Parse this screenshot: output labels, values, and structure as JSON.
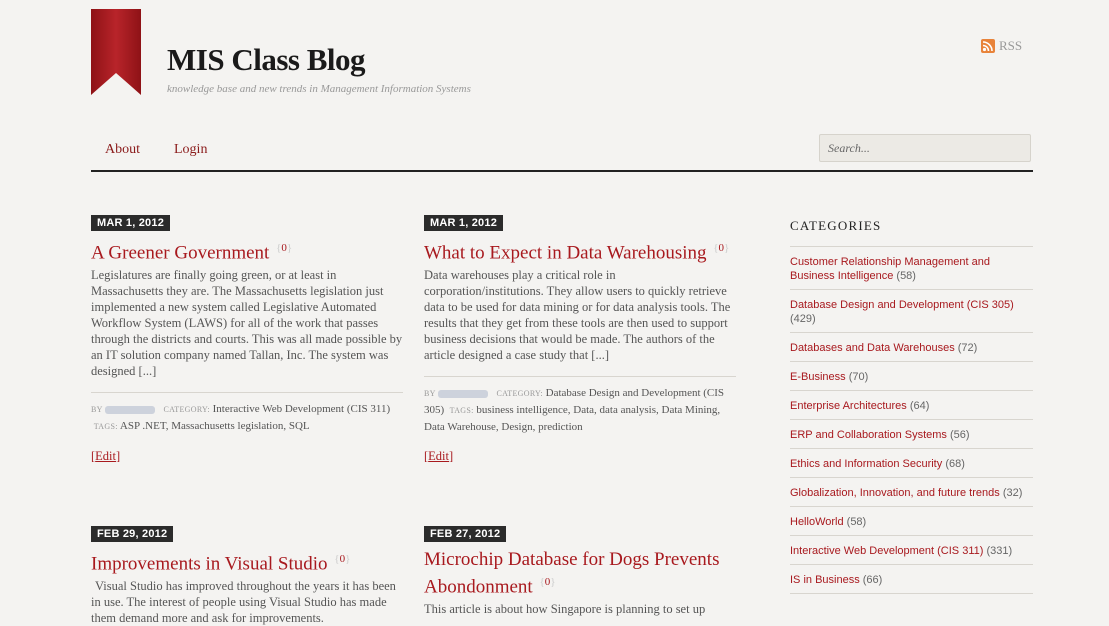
{
  "header": {
    "title": "MIS Class Blog",
    "tagline": "knowledge base and new trends in Management Information Systems",
    "rss_label": "RSS"
  },
  "nav": {
    "items": [
      "About",
      "Login"
    ]
  },
  "search": {
    "placeholder": "Search..."
  },
  "colors": {
    "accent": "#a8191e",
    "dark": "#2b2b2b",
    "background": "#f4f3f1"
  },
  "posts": [
    {
      "date": "MAR 1, 2012",
      "title": "A Greener Government",
      "comments": "0",
      "excerpt": "Legislatures are finally going green, or at least in Massachusetts they are. The Massachusetts legislation just implemented a new system called Legislative Automated Workflow System (LAWS) for all of the work that passes through the districts and courts. This was all made possible by an IT solution company named Tallan, Inc. The system was designed [...]",
      "by_label": "BY",
      "category_label": "CATEGORY:",
      "category": "Interactive Web Development (CIS 311)",
      "tags_label": "TAGS:",
      "tags": "ASP .NET, Massachusetts legislation, SQL",
      "edit": "Edit"
    },
    {
      "date": "MAR 1, 2012",
      "title": "What to Expect in Data Warehousing",
      "comments": "0",
      "excerpt": "Data warehouses play a critical role in corporation/institutions. They allow users to quickly retrieve data to be used for data mining or for data analysis tools. The results that they get from these tools are then used to support business decisions that would be made. The authors of the article designed a case study that [...]",
      "by_label": "BY",
      "category_label": "CATEGORY:",
      "category": "Database Design and Development (CIS 305)",
      "tags_label": "TAGS:",
      "tags": "business intelligence, Data, data analysis, Data Mining, Data Warehouse, Design, prediction",
      "edit": "Edit"
    },
    {
      "date": "FEB 29, 2012",
      "title": "Improvements in Visual Studio",
      "comments": "0",
      "excerpt": "Visual Studio has improved throughout the years it has been in use. The interest of people using Visual Studio has made them demand more and ask for improvements."
    },
    {
      "date": "FEB 27, 2012",
      "title": "Microchip Database for Dogs Prevents Abondonment",
      "comments": "0",
      "excerpt": "This article is about how Singapore is planning to set up"
    }
  ],
  "sidebar": {
    "title": "CATEGORIES",
    "categories": [
      {
        "name": "Customer Relationship Management and Business Intelligence",
        "count": "(58)"
      },
      {
        "name": "Database Design and Development (CIS 305)",
        "count": "(429)"
      },
      {
        "name": "Databases and Data Warehouses",
        "count": "(72)"
      },
      {
        "name": "E-Business",
        "count": "(70)"
      },
      {
        "name": "Enterprise Architectures",
        "count": "(64)"
      },
      {
        "name": "ERP and Collaboration Systems",
        "count": "(56)"
      },
      {
        "name": "Ethics and Information Security",
        "count": "(68)"
      },
      {
        "name": "Globalization, Innovation, and future trends",
        "count": "(32)"
      },
      {
        "name": "HelloWorld",
        "count": "(58)"
      },
      {
        "name": "Interactive Web Development (CIS 311)",
        "count": "(331)"
      },
      {
        "name": "IS in Business",
        "count": "(66)"
      }
    ]
  }
}
